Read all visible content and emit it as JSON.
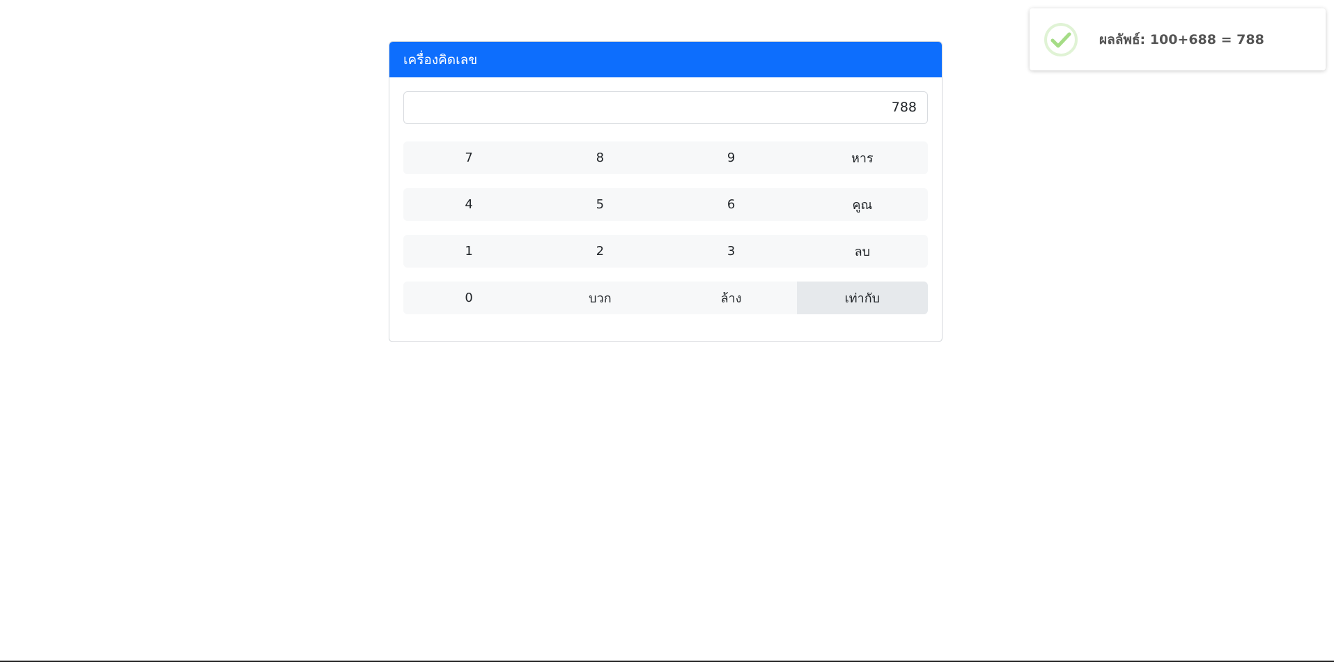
{
  "calculator": {
    "title": "เครื่องคิดเลข",
    "display_value": "788",
    "rows": [
      [
        "7",
        "8",
        "9",
        "หาร"
      ],
      [
        "4",
        "5",
        "6",
        "คูณ"
      ],
      [
        "1",
        "2",
        "3",
        "ลบ"
      ],
      [
        "0",
        "บวก",
        "ล้าง",
        "เท่ากับ"
      ]
    ]
  },
  "toast": {
    "message": "ผลลัพธ์: 100+688 = 788",
    "icon": "success-check-icon"
  },
  "colors": {
    "header": "#0d6efd",
    "key_bg": "#f7f8f9",
    "key_active_bg": "#e6e9ec",
    "success_icon": "#a5dc86"
  }
}
